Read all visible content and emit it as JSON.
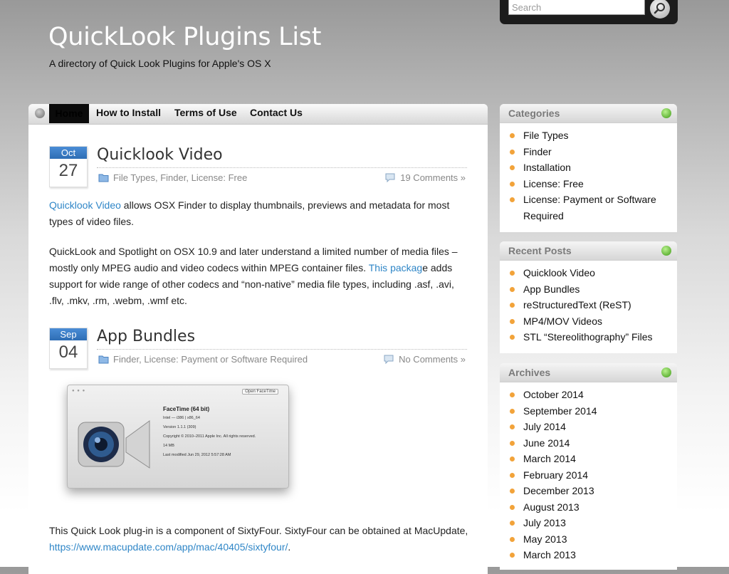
{
  "header": {
    "title": "QuickLook Plugins List",
    "description": "A directory of Quick Look Plugins for Apple's OS X"
  },
  "search": {
    "placeholder": "Search",
    "value": ""
  },
  "nav": {
    "home": "Home",
    "items": [
      "How to Install",
      "Terms of Use",
      "Contact Us"
    ]
  },
  "posts": [
    {
      "month": "Oct",
      "day": "27",
      "title": "Quicklook Video",
      "categories": "File Types, Finder, License: Free",
      "comments": "19 Comments »",
      "p1_link": "Quicklook Video",
      "p1_rest": " allows OSX Finder to display thumbnails, previews and metadata for most types of video files.",
      "p2_start": "QuickLook and Spotlight on OSX 10.9 and later understand a limited number of media files – mostly only MPEG audio and video codecs within MPEG container files. ",
      "p2_link": "This packag",
      "p2_rest": "e adds support for wide range of other codecs and “non-native” media file types, including .asf, .avi, .flv, .mkv, .rm, .webm, .wmf etc."
    },
    {
      "month": "Sep",
      "day": "04",
      "title": "App Bundles",
      "categories": "Finder, License: Payment or Software Required",
      "comments": "No Comments »",
      "p1_start": "This Quick Look plug-in is a component of SixtyFour. SixtyFour can be obtained at MacUpdate, ",
      "p1_link": "https://www.macupdate.com/app/mac/40405/sixtyfour/",
      "p1_end": "."
    }
  ],
  "facetime": {
    "button": "Open FaceTime",
    "name": "FaceTime (64 bit)",
    "arch": "Intel — i386 | x86_64",
    "version": "Version 1.1.1 (309)",
    "copyright": "Copyright © 2010–2011 Apple Inc. All rights reserved.",
    "size": "14 MB",
    "modified": "Last modified Jun 29, 2012 5:57:28 AM"
  },
  "sidebar": {
    "categories": {
      "title": "Categories",
      "items": [
        "File Types",
        "Finder",
        "Installation",
        "License: Free",
        "License: Payment or Software Required"
      ]
    },
    "recent": {
      "title": "Recent Posts",
      "items": [
        "Quicklook Video",
        "App Bundles",
        "reStructuredText (ReST)",
        "MP4/MOV Videos",
        "STL “Stereolithography” Files"
      ]
    },
    "archives": {
      "title": "Archives",
      "items": [
        "October 2014",
        "September 2014",
        "July 2014",
        "June 2014",
        "March 2014",
        "February 2014",
        "December 2013",
        "August 2013",
        "July 2013",
        "May 2013",
        "March 2013"
      ]
    }
  },
  "colors": {
    "accent_link": "#2f86c7",
    "bullet": "#f2a33a",
    "calendar": "#2e6db4",
    "widget_dot": "#3f9a17"
  }
}
